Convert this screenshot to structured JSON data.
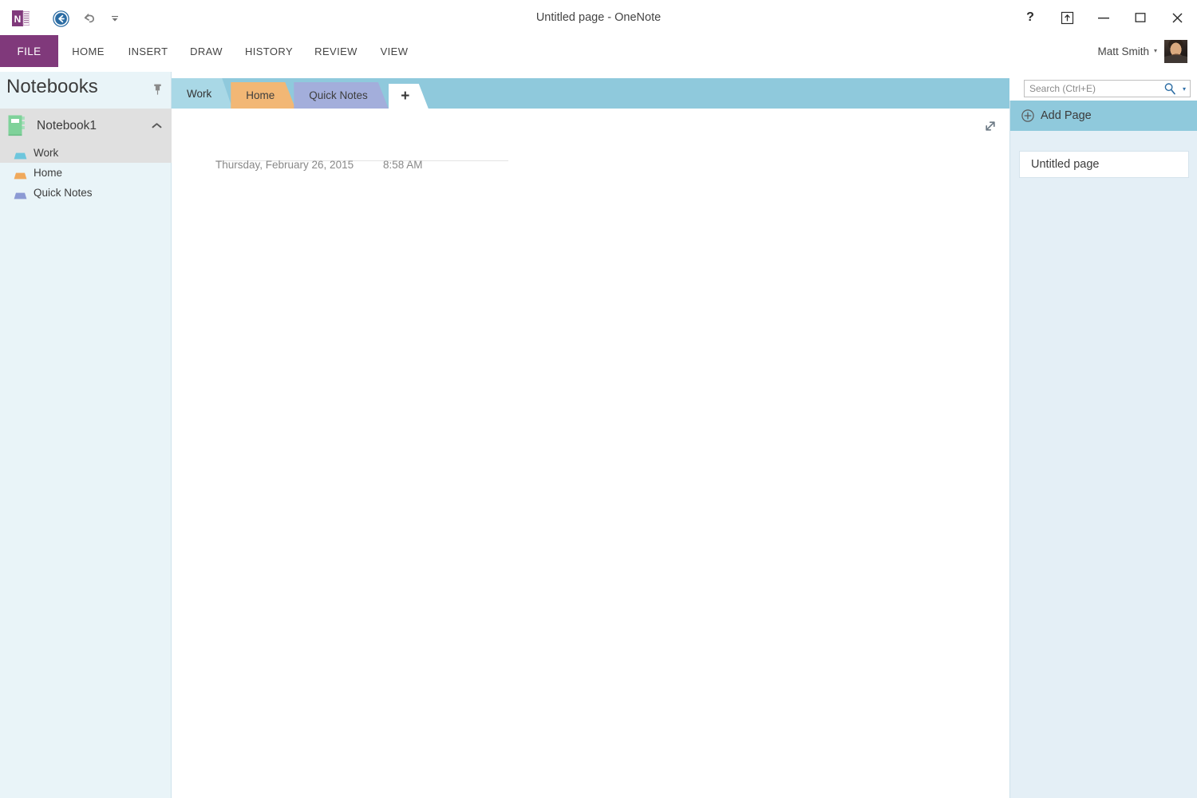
{
  "window": {
    "title": "Untitled page - OneNote",
    "logo_icon": "onenote-logo-icon",
    "quick_access": [
      {
        "name": "back-button",
        "icon": "back-arrow-circle-icon"
      },
      {
        "name": "undo-button",
        "icon": "undo-arrow-icon"
      },
      {
        "name": "customize-quick-access-button",
        "icon": "chevron-down-small-icon"
      }
    ],
    "controls": [
      {
        "name": "help-button",
        "icon": "question-mark-icon",
        "glyph": "?"
      },
      {
        "name": "ribbon-display-options-button",
        "icon": "ribbon-options-icon",
        "glyph": ""
      },
      {
        "name": "minimize-button",
        "icon": "minimize-icon",
        "glyph": ""
      },
      {
        "name": "restore-button",
        "icon": "restore-window-icon",
        "glyph": ""
      },
      {
        "name": "close-button",
        "icon": "close-icon",
        "glyph": ""
      }
    ]
  },
  "ribbon": {
    "tabs": [
      {
        "label": "FILE",
        "active": true
      },
      {
        "label": "HOME",
        "active": false
      },
      {
        "label": "INSERT",
        "active": false
      },
      {
        "label": "DRAW",
        "active": false
      },
      {
        "label": "HISTORY",
        "active": false
      },
      {
        "label": "REVIEW",
        "active": false
      },
      {
        "label": "VIEW",
        "active": false
      }
    ],
    "file_tab_color": "#80397b"
  },
  "account": {
    "name": "Matt Smith",
    "caret": "▾",
    "avatar_icon": "user-avatar-photo"
  },
  "sidebar": {
    "title": "Notebooks",
    "pin_icon": "pushpin-icon",
    "notebook": {
      "name": "Notebook1",
      "icon": "notebook-icon",
      "icon_color": "#7fd29a",
      "collapse_icon": "chevron-up-icon",
      "expanded": true
    },
    "sections": [
      {
        "label": "Work",
        "color": "#6ec6dd",
        "selected": true,
        "icon": "section-tab-icon"
      },
      {
        "label": "Home",
        "color": "#f0a95c",
        "selected": false,
        "icon": "section-tab-icon"
      },
      {
        "label": "Quick Notes",
        "color": "#8c9ad4",
        "selected": false,
        "icon": "section-tab-icon"
      }
    ]
  },
  "section_tabs": {
    "strip_color": "#8fc9dc",
    "items": [
      {
        "label": "Work",
        "color": "#a9d8e6",
        "active": true
      },
      {
        "label": "Home",
        "color": "#f2b775",
        "active": false
      },
      {
        "label": "Quick Notes",
        "color": "#a3aedb",
        "active": false
      }
    ],
    "add_section": {
      "label": "+",
      "name": "add-section-button"
    }
  },
  "page": {
    "title": "",
    "title_placeholder": "",
    "date": "Thursday, February 26, 2015",
    "time": "8:58 AM",
    "fullpage_icon": "expand-diagonal-arrows-icon"
  },
  "search": {
    "placeholder": "Search (Ctrl+E)",
    "value": "",
    "icon": "search-magnifier-icon",
    "caret": "▾"
  },
  "page_panel": {
    "add_page_label": "Add Page",
    "add_page_icon": "plus-circle-icon",
    "background_color": "#e4eff6",
    "pages": [
      {
        "label": "Untitled page",
        "selected": true
      }
    ]
  }
}
